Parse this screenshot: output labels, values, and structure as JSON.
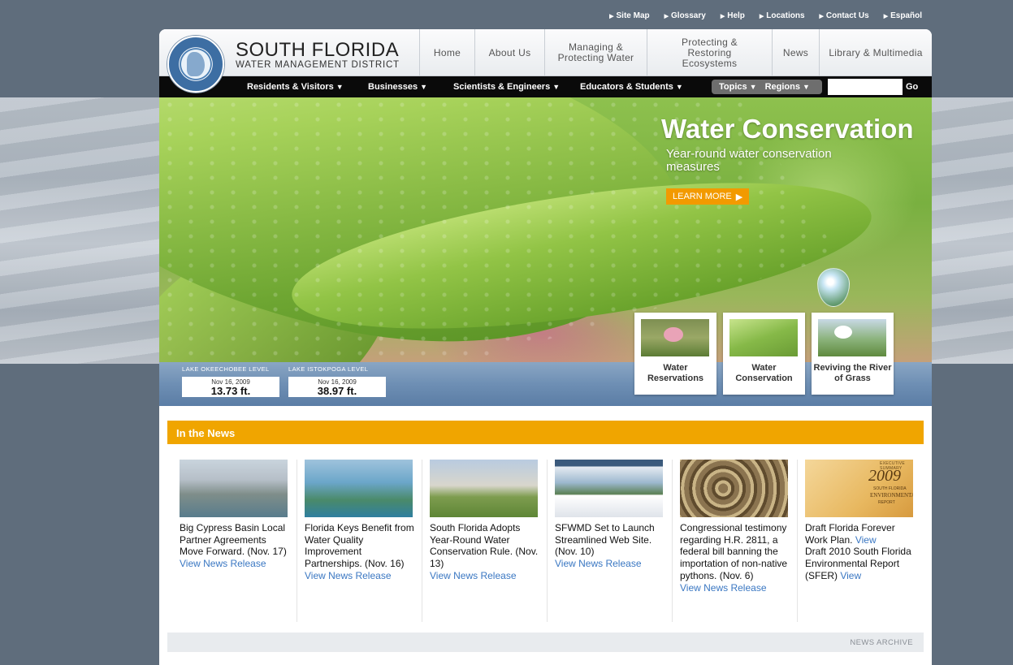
{
  "utility_links": [
    "Site Map",
    "Glossary",
    "Help",
    "Locations",
    "Contact Us",
    "Español"
  ],
  "brand": {
    "title": "SOUTH FLORIDA",
    "subtitle": "WATER MANAGEMENT DISTRICT",
    "seal_text": "SOUTH FLORIDA WATER MANAGEMENT DISTRICT"
  },
  "main_nav": [
    "Home",
    "About Us",
    "Managing & Protecting Water",
    "Protecting & Restoring Ecosystems",
    "News",
    "Library & Multimedia"
  ],
  "audience_nav": [
    "Residents & Visitors",
    "Businesses",
    "Scientists & Engineers",
    "Educators & Students"
  ],
  "filters": {
    "topics": "Topics",
    "regions": "Regions"
  },
  "search": {
    "value": "",
    "go": "Go"
  },
  "hero": {
    "title": "Water Conservation",
    "subtitle": "Year-round water conservation measures",
    "button": "LEARN MORE"
  },
  "lake_levels": [
    {
      "label": "LAKE OKEECHOBEE LEVEL",
      "date": "Nov 16, 2009",
      "value": "13.73 ft."
    },
    {
      "label": "LAKE ISTOKPOGA LEVEL",
      "date": "Nov 16, 2009",
      "value": "38.97 ft."
    }
  ],
  "tiles": [
    {
      "caption": "Water Reservations"
    },
    {
      "caption": "Water Conservation"
    },
    {
      "caption": "Reviving the River of Grass"
    }
  ],
  "news": {
    "heading": "In the News",
    "items": [
      {
        "text": "Big Cypress Basin Local Partner Agreements Move Forward. (Nov. 17)",
        "link": "View News Release"
      },
      {
        "text": "Florida Keys Benefit from Water Quality Improvement Partnerships. (Nov. 16)",
        "link": "View News Release"
      },
      {
        "text": "South Florida Adopts Year-Round Water Conservation Rule. (Nov. 13)",
        "link": "View News Release"
      },
      {
        "text": "SFWMD Set to Launch Streamlined Web Site. (Nov. 10)",
        "link": "View News Release"
      },
      {
        "text": "Congressional testimony regarding H.R. 2811, a federal bill banning the importation of non-native pythons. (Nov. 6)",
        "link": "View News Release"
      },
      {
        "text_a": "Draft Florida Forever Work Plan.",
        "link_a": "View",
        "text_b": "Draft 2010 South Florida Environmental Report (SFER)",
        "link_b": "View"
      }
    ],
    "report_cover": {
      "year": "2009",
      "lines": [
        "EXECUTIVE SUMMARY",
        "SOUTH FLORIDA",
        "ENVIRONMENTAL",
        "REPORT"
      ]
    },
    "archive": "NEWS ARCHIVE"
  }
}
